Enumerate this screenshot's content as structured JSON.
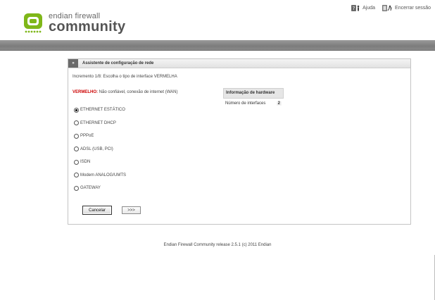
{
  "header": {
    "help_label": "Ajuda",
    "logout_label": "Encerrar sessão",
    "logo_line1": "endian firewall",
    "logo_line2": "community"
  },
  "wizard": {
    "title": "Assistente de configuração de rede",
    "step_text": "Incremento 1/8: Escolha o tipo de interface VERMELHA",
    "zone_label": "VERMELHO:",
    "zone_desc": "Não confiável, conexão de internet (WAN)",
    "options": [
      {
        "label": "ETHERNET ESTÁTICO",
        "selected": true
      },
      {
        "label": "ETHERNET DHCP",
        "selected": false
      },
      {
        "label": "PPPoE",
        "selected": false
      },
      {
        "label": "ADSL (USB, PCI)",
        "selected": false
      },
      {
        "label": "ISDN",
        "selected": false
      },
      {
        "label": "Modem ANALOG/UMTS",
        "selected": false
      },
      {
        "label": "GATEWAY",
        "selected": false
      }
    ],
    "hardware": {
      "title": "Informação de hardware",
      "interfaces_label": "Número de interfaces",
      "interfaces_value": "2"
    },
    "cancel_label": "Cancelar",
    "next_label": ">>>"
  },
  "footer": {
    "text": "Endian Firewall Community release 2.5.1 (c) 2011 Endian"
  },
  "colors": {
    "accent_red": "#cc0000",
    "logo_green": "#7fb719"
  },
  "icons": {
    "help": "help-icon",
    "logout": "logout-icon",
    "chevron": "double-chevron-icon"
  }
}
